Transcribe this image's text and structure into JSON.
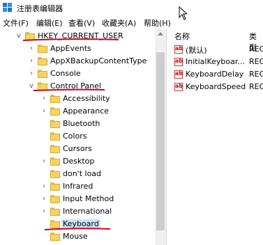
{
  "window": {
    "title": "注册表编辑器"
  },
  "menu": [
    "文件(F)",
    "编辑(E)",
    "查看(V)",
    "收藏夹(A)",
    "帮助(H)"
  ],
  "tree": {
    "root": {
      "label": "HKEY_CURRENT_USER",
      "expanded": true
    },
    "items": [
      {
        "label": "AppEvents",
        "expander": "›"
      },
      {
        "label": "AppXBackupContentType",
        "expander": "›"
      },
      {
        "label": "Console",
        "expander": "›"
      },
      {
        "label": "Control Panel",
        "expander": "v"
      }
    ],
    "control_panel_children": [
      {
        "label": "Accessibility",
        "expander": "›"
      },
      {
        "label": "Appearance",
        "expander": "›"
      },
      {
        "label": "Bluetooth",
        "expander": ""
      },
      {
        "label": "Colors",
        "expander": ""
      },
      {
        "label": "Cursors",
        "expander": ""
      },
      {
        "label": "Desktop",
        "expander": "›"
      },
      {
        "label": "don't load",
        "expander": ""
      },
      {
        "label": "Infrared",
        "expander": "›"
      },
      {
        "label": "Input Method",
        "expander": "›"
      },
      {
        "label": "International",
        "expander": "›"
      },
      {
        "label": "Keyboard",
        "expander": "",
        "selected": true
      },
      {
        "label": "Mouse",
        "expander": ""
      }
    ]
  },
  "list": {
    "columns": {
      "name": "名称",
      "type": "类型"
    },
    "rows": [
      {
        "name": "(默认)",
        "type": "REG"
      },
      {
        "name": "InitialKeyboar...",
        "type": "REG"
      },
      {
        "name": "KeyboardDelay",
        "type": "REG"
      },
      {
        "name": "KeyboardSpeed",
        "type": "REG"
      }
    ]
  },
  "colors": {
    "annotation": "#d0021b",
    "selection": "#cce4f7",
    "folder": "#f6d365"
  },
  "icons": {
    "app": "registry-editor-icon",
    "folder": "folder-icon",
    "value": "string-value-icon"
  }
}
